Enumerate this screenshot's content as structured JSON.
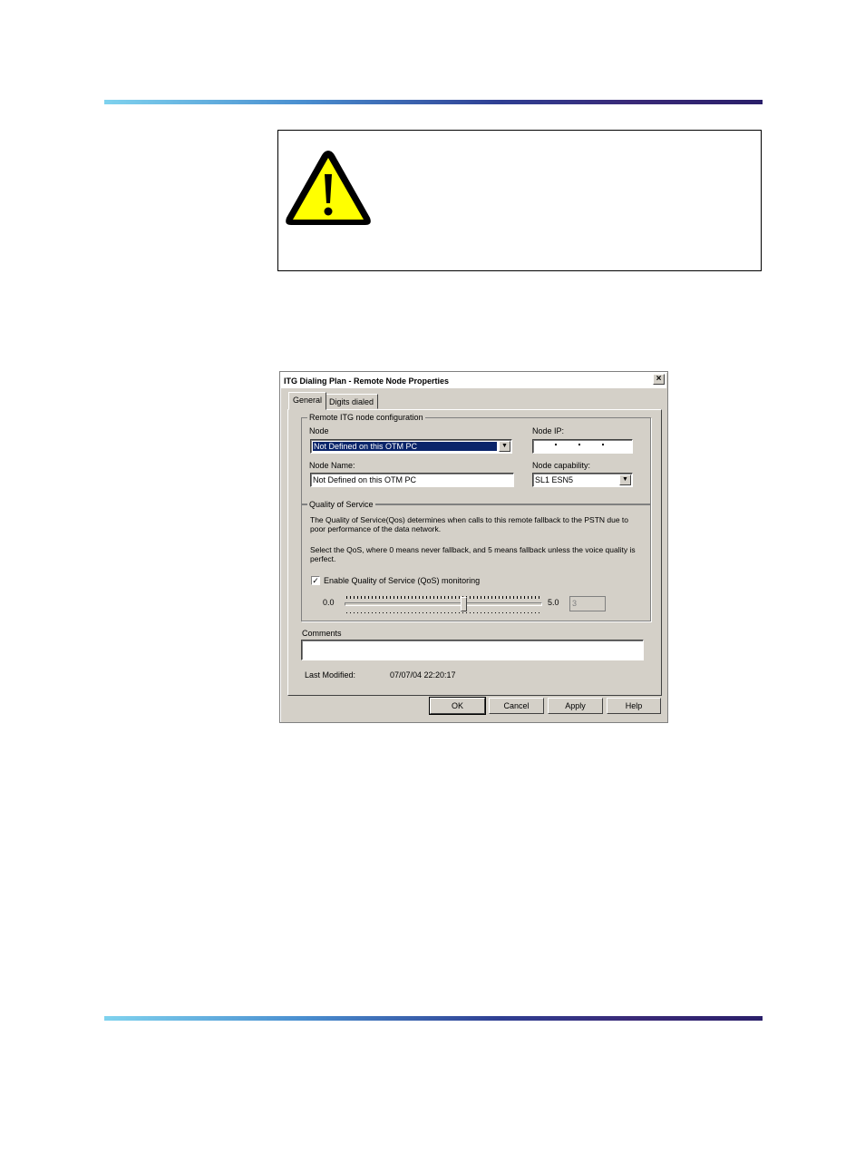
{
  "dialog": {
    "title": "ITG Dialing Plan - Remote Node Properties",
    "close_glyph": "×",
    "tabs": [
      "General",
      "Digits dialed"
    ],
    "remote_group": {
      "title": "Remote ITG node configuration",
      "node_label": "Node",
      "node_value": "Not Defined on this OTM PC",
      "node_ip_label": "Node IP:",
      "node_name_label": "Node Name:",
      "node_name_value": "Not Defined on this OTM PC",
      "node_capability_label": "Node capability:",
      "node_capability_value": "SL1 ESN5"
    },
    "qos_group": {
      "title": "Quality of Service",
      "desc1": "The Quality of Service(Qos) determines when calls to this remote fallback to the PSTN due to poor performance of the data network.",
      "desc2": "Select the QoS, where 0 means never fallback, and 5 means fallback unless the voice quality is perfect.",
      "enable_label": "Enable Quality of Service (QoS) monitoring",
      "enable_checked": true,
      "check_glyph": "✓",
      "slider_min_label": "0.0",
      "slider_max_label": "5.0",
      "slider_value": "3",
      "slider_fraction": 0.6
    },
    "comments_label": "Comments",
    "comments_value": "",
    "last_modified_label": "Last Modified:",
    "last_modified_value": "07/07/04 22:20:17",
    "buttons": {
      "ok": "OK",
      "cancel": "Cancel",
      "apply": "Apply",
      "help": "Help"
    }
  },
  "icons": {
    "caution": "caution-triangle-icon",
    "dropdown": "chevron-down-icon"
  },
  "colors": {
    "caution_yellow": "#ffff00",
    "selection_blue": "#0a246a"
  }
}
